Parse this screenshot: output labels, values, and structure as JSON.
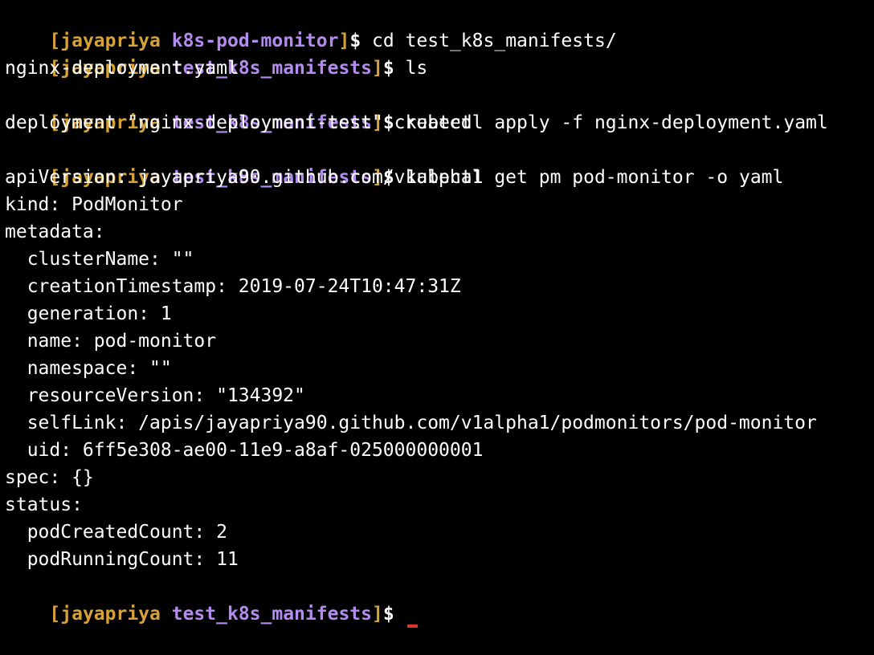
{
  "theme": {
    "background": "#000000",
    "text": "#ffffff",
    "prompt_bracket_user": "#d7a338",
    "prompt_dir": "#b48cf0",
    "cursor": "#e0342d"
  },
  "prompts": [
    {
      "user": "jayapriya",
      "dir": "k8s-pod-monitor",
      "command": "cd test_k8s_manifests/"
    },
    {
      "user": "jayapriya",
      "dir": "test_k8s_manifests",
      "command": "ls"
    },
    {
      "user": "jayapriya",
      "dir": "test_k8s_manifests",
      "command": "kubectl apply -f nginx-deployment.yaml"
    },
    {
      "user": "jayapriya",
      "dir": "test_k8s_manifests",
      "command": "kubectl get pm pod-monitor -o yaml"
    },
    {
      "user": "jayapriya",
      "dir": "test_k8s_manifests",
      "command": ""
    }
  ],
  "outputs": {
    "ls": "nginx-deployment.yaml",
    "apply": "deployment \"nginx-deployment-test\" created",
    "yaml": [
      "apiVersion: jayapriya90.github.com/v1alpha1",
      "kind: PodMonitor",
      "metadata:",
      "  clusterName: \"\"",
      "  creationTimestamp: 2019-07-24T10:47:31Z",
      "  generation: 1",
      "  name: pod-monitor",
      "  namespace: \"\"",
      "  resourceVersion: \"134392\"",
      "  selfLink: /apis/jayapriya90.github.com/v1alpha1/podmonitors/pod-monitor",
      "  uid: 6ff5e308-ae00-11e9-a8af-025000000001",
      "spec: {}",
      "status:",
      "  podCreatedCount: 2",
      "  podRunningCount: 11"
    ]
  }
}
